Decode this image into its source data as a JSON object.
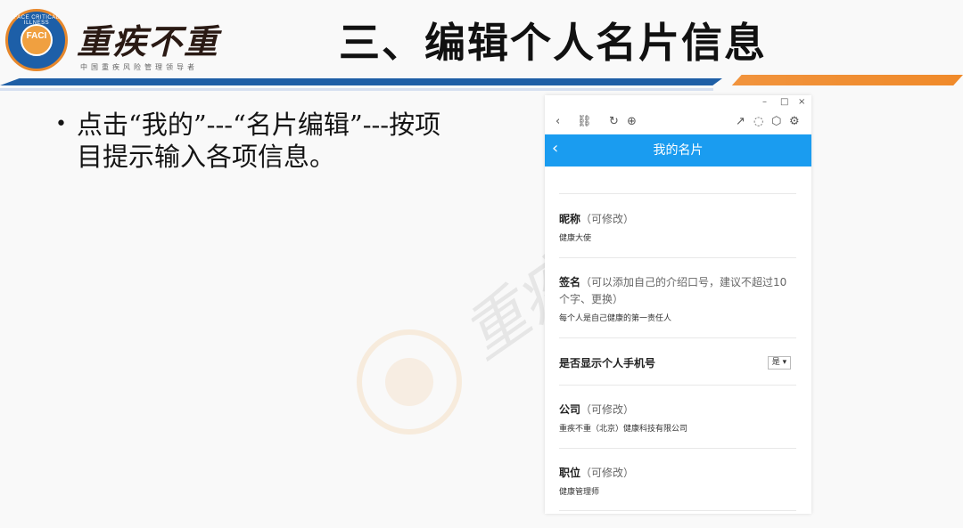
{
  "header": {
    "logo_name": "重疾不重",
    "logo_subtitle": "中国重疾风险管理领导者",
    "logo_badge_text": "FACI",
    "logo_ring_text": "FACE CRITICAL ILLNESS",
    "slide_title": "三、编辑个人名片信息"
  },
  "bullet": {
    "text": "点击“我的”---“名片编辑”---按项目提示输入各项信息。"
  },
  "watermark": {
    "text": "重疾不重"
  },
  "phone": {
    "window_controls": [
      "–",
      "□",
      "×"
    ],
    "toolbar_icons": [
      "back",
      "link",
      "refresh",
      "globe",
      "share",
      "chat",
      "cube",
      "settings"
    ],
    "nav_title": "我的名片",
    "fields": [
      {
        "label": "昵称",
        "hint": "（可修改）",
        "value": "健康大使"
      },
      {
        "label": "签名",
        "hint": "（可以添加自己的介绍口号，建议不超过10个字、更换）",
        "value": "每个人是自己健康的第一责任人"
      },
      {
        "label": "是否显示个人手机号",
        "hint": "",
        "value": "是"
      },
      {
        "label": "公司",
        "hint": "（可修改）",
        "value": "重疾不重（北京）健康科技有限公司"
      },
      {
        "label": "职位",
        "hint": "（可修改）",
        "value": "健康管理师"
      }
    ]
  },
  "colors": {
    "brand_blue": "#1f5fa6",
    "brand_orange": "#f08a2a",
    "nav_blue": "#1a9cf0"
  }
}
